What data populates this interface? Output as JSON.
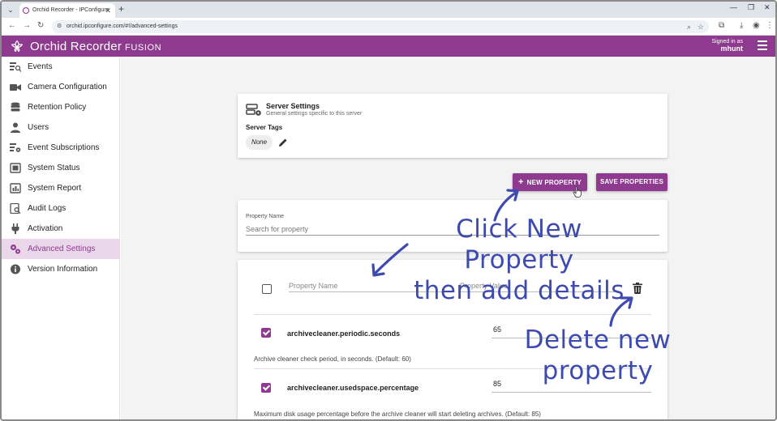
{
  "browser": {
    "tab_title": "Orchid Recorder - IPConfigure",
    "url": "orchid.ipconfigure.com/#!/advanced-settings"
  },
  "header": {
    "app_name": "Orchid Recorder",
    "app_suffix": "FUSION",
    "signed_in_label": "Signed in as",
    "username": "mhunt"
  },
  "sidebar": {
    "items": [
      {
        "label": "Events",
        "icon": "events-icon"
      },
      {
        "label": "Camera Configuration",
        "icon": "camera-icon"
      },
      {
        "label": "Retention Policy",
        "icon": "database-icon"
      },
      {
        "label": "Users",
        "icon": "user-icon"
      },
      {
        "label": "Event Subscriptions",
        "icon": "subscriptions-icon"
      },
      {
        "label": "System Status",
        "icon": "status-icon"
      },
      {
        "label": "System Report",
        "icon": "report-icon"
      },
      {
        "label": "Audit Logs",
        "icon": "audit-icon"
      },
      {
        "label": "Activation",
        "icon": "plug-icon"
      },
      {
        "label": "Advanced Settings",
        "icon": "gears-icon",
        "active": true
      },
      {
        "label": "Version Information",
        "icon": "info-icon"
      }
    ]
  },
  "server_settings": {
    "title": "Server Settings",
    "subtitle": "General settings specific to this server",
    "tags_label": "Server Tags",
    "tag_value": "None"
  },
  "actions": {
    "new_property": "NEW PROPERTY",
    "save_properties": "SAVE PROPERTIES"
  },
  "search": {
    "label": "Property Name",
    "placeholder": "Search for property"
  },
  "new_row": {
    "name_placeholder": "Property Name",
    "value_placeholder": "Property Value"
  },
  "properties": [
    {
      "name": "archivecleaner.periodic.seconds",
      "value": "65",
      "description": "Archive cleaner check period, in seconds. (Default: 60)"
    },
    {
      "name": "archivecleaner.usedspace.percentage",
      "value": "85",
      "description": "Maximum disk usage percentage before the archive cleaner will start deleting archives. (Default: 85)"
    }
  ],
  "annotations": {
    "new_property_line1": "Click New Property",
    "new_property_line2": "then add details",
    "delete_line1": "Delete new",
    "delete_line2": "property"
  },
  "colors": {
    "brand": "#8e3a8f",
    "annotation": "#3d4ab0",
    "active_nav_bg": "#ead7ea"
  }
}
